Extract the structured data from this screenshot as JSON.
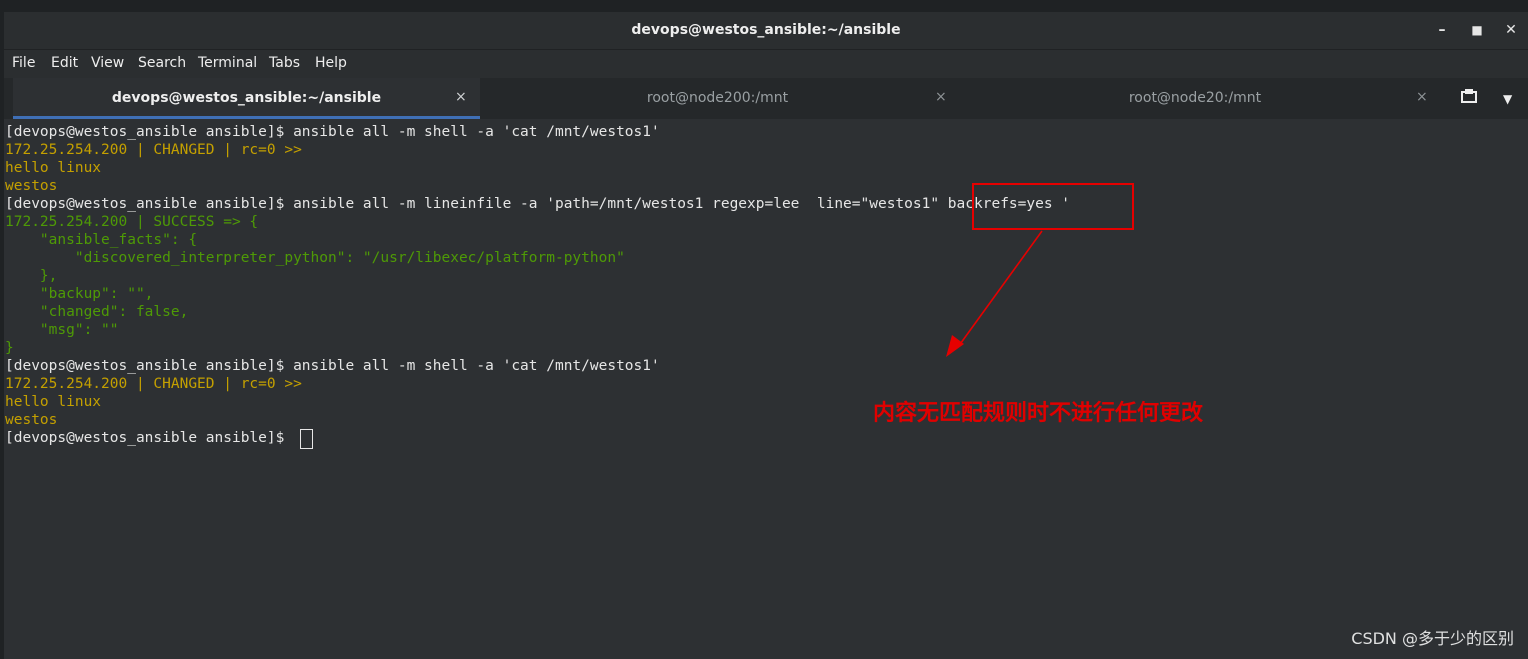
{
  "window": {
    "title": "devops@westos_ansible:~/ansible",
    "controls": [
      "minimize-icon",
      "maximize-icon",
      "close-icon"
    ]
  },
  "menu": [
    "File",
    "Edit",
    "View",
    "Search",
    "Terminal",
    "Tabs",
    "Help"
  ],
  "tabs": [
    {
      "label": "devops@westos_ansible:~/ansible",
      "active": true
    },
    {
      "label": "root@node200:/mnt",
      "active": false
    },
    {
      "label": "root@node20:/mnt",
      "active": false
    }
  ],
  "tab_close_glyph": "×",
  "tab_buttons": [
    "new-tab-icon",
    "tab-menu-icon"
  ],
  "terminal_lines": [
    {
      "text": "[devops@westos_ansible ansible]$ ansible all -m shell -a 'cat /mnt/westos1'",
      "color": "white"
    },
    {
      "text": "172.25.254.200 | CHANGED | rc=0 >>",
      "color": "yellow"
    },
    {
      "text": "hello linux",
      "color": "yellow"
    },
    {
      "text": "westos",
      "color": "yellow"
    },
    {
      "text": "[devops@westos_ansible ansible]$ ansible all -m lineinfile -a 'path=/mnt/westos1 regexp=lee  line=\"westos1\" backrefs=yes '",
      "color": "white"
    },
    {
      "text": "172.25.254.200 | SUCCESS => {",
      "color": "green"
    },
    {
      "text": "    \"ansible_facts\": {",
      "color": "green"
    },
    {
      "text": "        \"discovered_interpreter_python\": \"/usr/libexec/platform-python\"",
      "color": "green"
    },
    {
      "text": "    },",
      "color": "green"
    },
    {
      "text": "    \"backup\": \"\",",
      "color": "green"
    },
    {
      "text": "    \"changed\": false,",
      "color": "green"
    },
    {
      "text": "    \"msg\": \"\"",
      "color": "green"
    },
    {
      "text": "}",
      "color": "green"
    },
    {
      "text": "[devops@westos_ansible ansible]$ ansible all -m shell -a 'cat /mnt/westos1'",
      "color": "white"
    },
    {
      "text": "172.25.254.200 | CHANGED | rc=0 >>",
      "color": "yellow"
    },
    {
      "text": "hello linux",
      "color": "yellow"
    },
    {
      "text": "westos",
      "color": "yellow"
    },
    {
      "text": "[devops@westos_ansible ansible]$ ",
      "color": "white"
    }
  ],
  "annotation": {
    "text": "内容无匹配规则时不进行任何更改",
    "color": "#e00000"
  },
  "watermark": "CSDN @多于少的区别",
  "colors": {
    "terminal_bg": "#2d3033",
    "prompt": "#e6e6e6",
    "changed_output": "#c4a000",
    "success_output": "#4e9a06",
    "active_tab_indicator": "#3f6fb6"
  }
}
